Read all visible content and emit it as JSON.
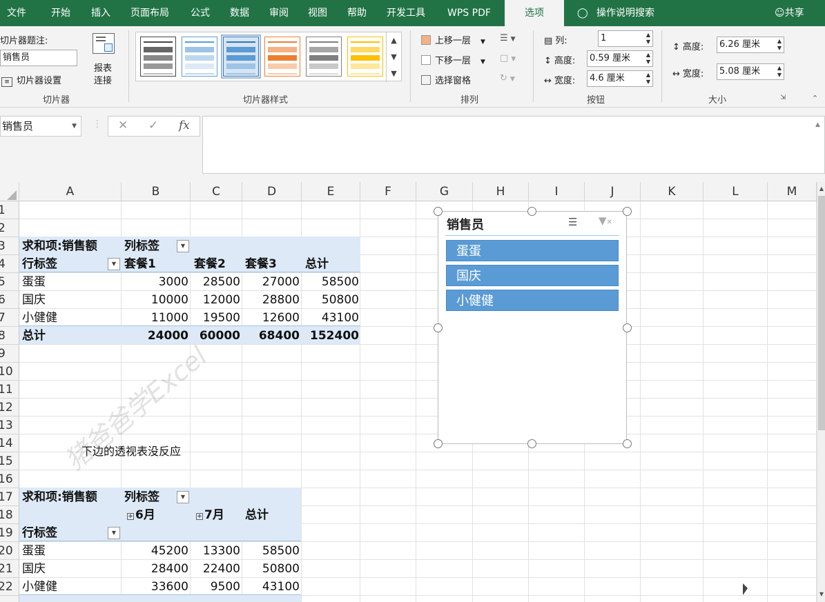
{
  "menu": {
    "tabs": [
      "文件",
      "开始",
      "插入",
      "页面布局",
      "公式",
      "数据",
      "审阅",
      "视图",
      "帮助",
      "开发工具",
      "WPS PDF",
      "选项"
    ],
    "active_tab": "选项",
    "help_search": "操作说明搜索",
    "share": "共享"
  },
  "ribbon": {
    "slicer_group": {
      "caption_label": "切片器题注:",
      "caption_value": "销售员",
      "settings_label": "切片器设置",
      "report_conn_line1": "报表",
      "report_conn_line2": "连接",
      "group_label": "切片器"
    },
    "styles_group": {
      "group_label": "切片器样式"
    },
    "arrange_group": {
      "bring_forward": "上移一层",
      "send_backward": "下移一层",
      "selection_pane": "选择窗格",
      "group_label": "排列"
    },
    "buttons_group": {
      "columns_label": "列:",
      "columns_value": "1",
      "height_label": "高度:",
      "height_value": "0.59 厘米",
      "width_label": "宽度:",
      "width_value": "4.6 厘米",
      "group_label": "按钮"
    },
    "size_group": {
      "height_label": "高度:",
      "height_value": "6.26 厘米",
      "width_label": "宽度:",
      "width_value": "5.08 厘米",
      "group_label": "大小"
    }
  },
  "formula_bar": {
    "name_box": "销售员",
    "formula": ""
  },
  "columns": [
    "A",
    "B",
    "C",
    "D",
    "E",
    "F",
    "G",
    "H",
    "I",
    "J",
    "K",
    "L",
    "M"
  ],
  "rows": [
    "1",
    "2",
    "3",
    "4",
    "5",
    "6",
    "7",
    "8",
    "9",
    "10",
    "11",
    "12",
    "13",
    "14",
    "15",
    "16",
    "17",
    "18",
    "19",
    "20",
    "21",
    "22"
  ],
  "pivot1": {
    "header_sum": "求和项:销售额",
    "col_label": "列标签",
    "row_label": "行标签",
    "col_headers": [
      "套餐1",
      "套餐2",
      "套餐3",
      "总计"
    ],
    "rows": [
      [
        "蛋蛋",
        "3000",
        "28500",
        "27000",
        "58500"
      ],
      [
        "国庆",
        "10000",
        "12000",
        "28800",
        "50800"
      ],
      [
        "小健健",
        "11000",
        "19500",
        "12600",
        "43100"
      ]
    ],
    "total": [
      "总计",
      "24000",
      "60000",
      "68400",
      "152400"
    ]
  },
  "note": "下边的透视表没反应",
  "pivot2": {
    "header_sum": "求和项:销售额",
    "col_label": "列标签",
    "row_label": "行标签",
    "col_headers": [
      "6月",
      "7月",
      "总计"
    ],
    "rows": [
      [
        "蛋蛋",
        "45200",
        "13300",
        "58500"
      ],
      [
        "国庆",
        "28400",
        "22400",
        "50800"
      ],
      [
        "小健健",
        "33600",
        "9500",
        "43100"
      ]
    ]
  },
  "slicer": {
    "title": "销售员",
    "items": [
      "蛋蛋",
      "国庆",
      "小健健"
    ]
  },
  "watermark": "猪爸爸学Excel",
  "colors": {
    "accent": "#217346",
    "slicer_item": "#5b9bd5",
    "pivot_band": "#dde9f6"
  }
}
